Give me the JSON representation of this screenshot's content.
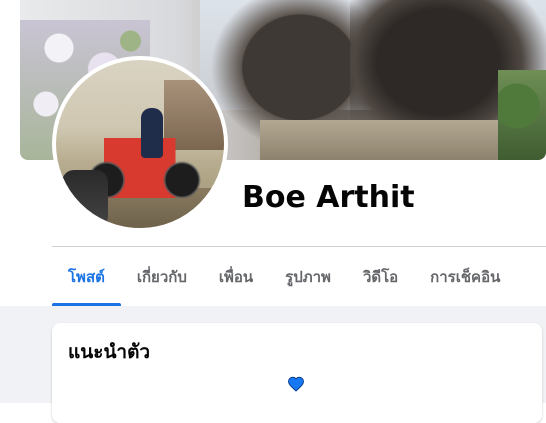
{
  "profile": {
    "name": "Boe Arthit"
  },
  "tabs": [
    {
      "label": "โพสต์",
      "active": true
    },
    {
      "label": "เกี่ยวกับ",
      "active": false
    },
    {
      "label": "เพื่อน",
      "active": false
    },
    {
      "label": "รูปภาพ",
      "active": false
    },
    {
      "label": "วิดีโอ",
      "active": false
    },
    {
      "label": "การเช็คอิน",
      "active": false
    }
  ],
  "intro": {
    "title": "แนะนำตัว",
    "icon": "heart-icon"
  },
  "colors": {
    "accent": "#1b74e4",
    "heart": "#1877f2"
  }
}
